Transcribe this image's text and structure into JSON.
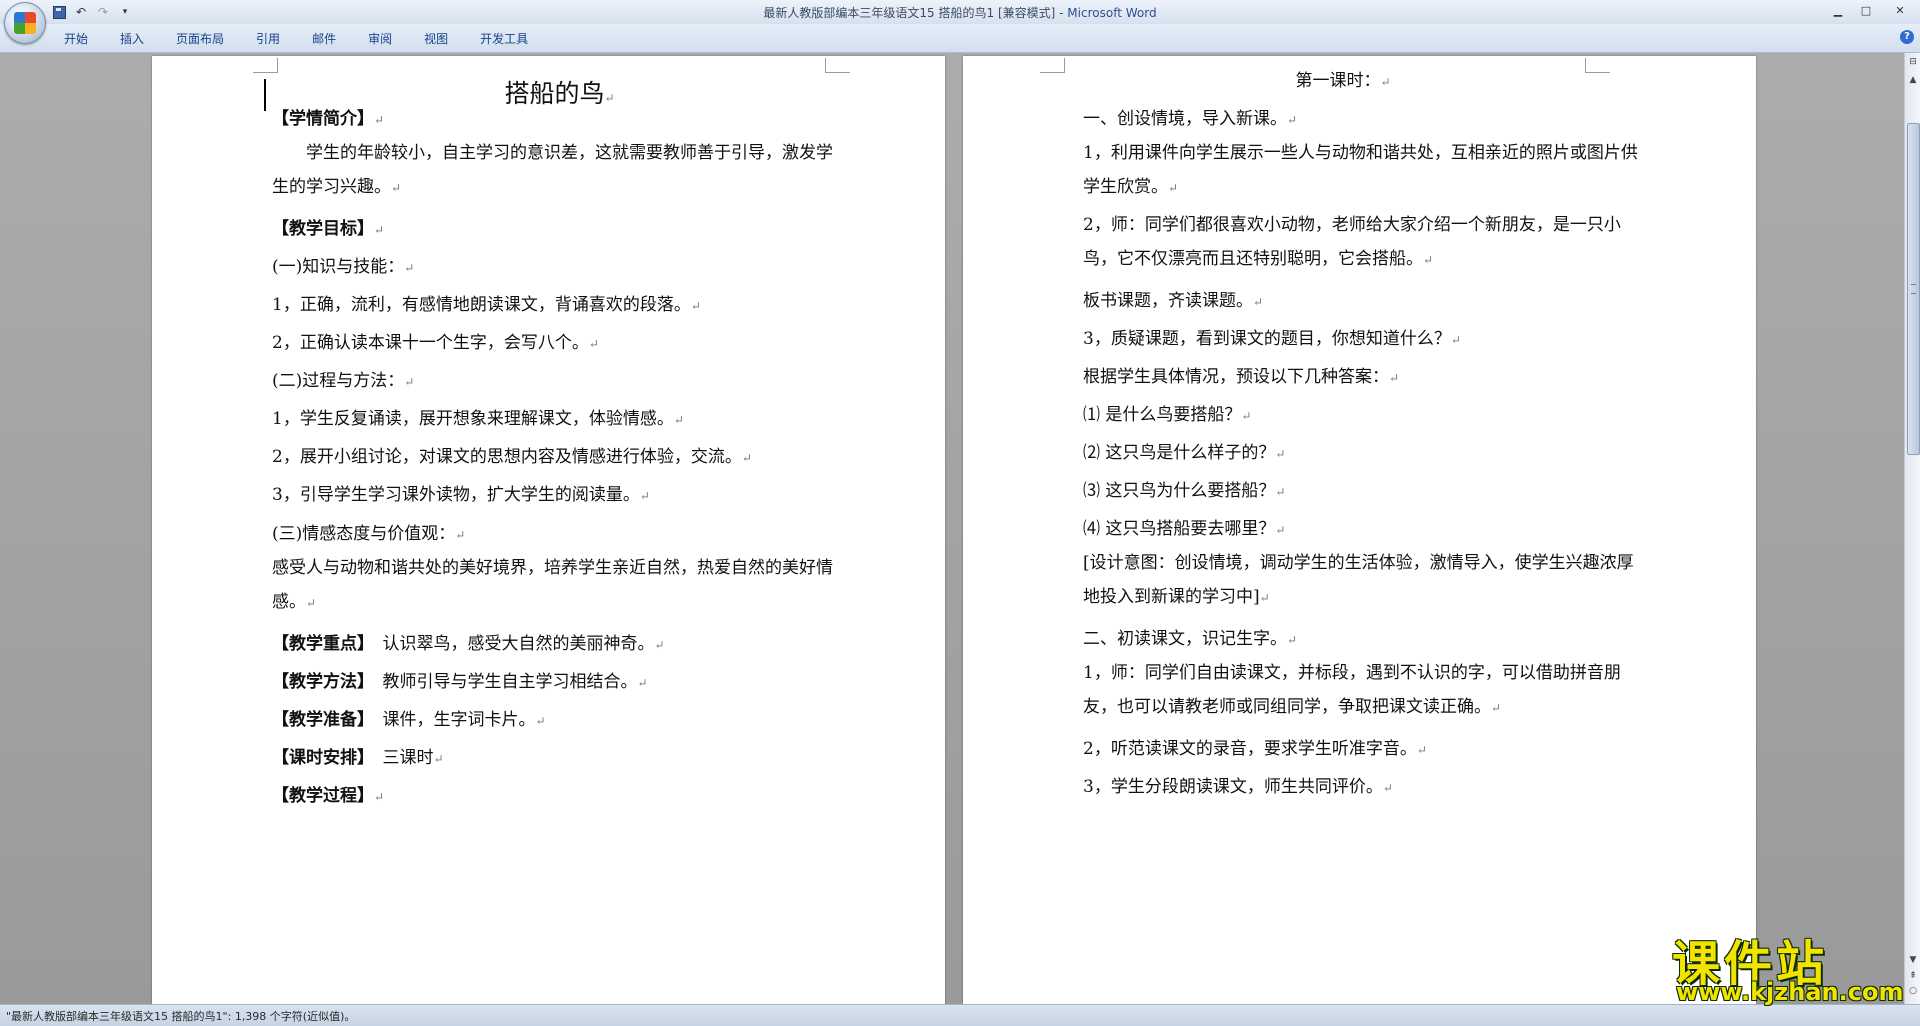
{
  "window": {
    "title": "最新人教版部编本三年级语文15 搭船的鸟1 [兼容模式]",
    "app_separator": " - ",
    "app_name": "Microsoft Word",
    "minimize": "▁",
    "maximize": "□",
    "close": "✕"
  },
  "qat": {
    "undo": "↶",
    "redo": "↷",
    "more": "▾"
  },
  "ribbon": {
    "tabs": [
      "开始",
      "插入",
      "页面布局",
      "引用",
      "邮件",
      "审阅",
      "视图",
      "开发工具"
    ],
    "help": "?"
  },
  "marks": {
    "para": "↵"
  },
  "document": {
    "left_page": {
      "title": "搭船的鸟",
      "paragraphs": [
        {
          "bold": "【学情简介】",
          "text": ""
        },
        {
          "bold": "",
          "text": "　　学生的年龄较小，自主学习的意识差，这就需要教师善于引导，激发学生的学习兴趣。"
        },
        {
          "bold": "【教学目标】",
          "text": ""
        },
        {
          "bold": "",
          "text": "(一)知识与技能："
        },
        {
          "bold": "",
          "text": "1，正确，流利，有感情地朗读课文，背诵喜欢的段落。"
        },
        {
          "bold": "",
          "text": "2，正确认读本课十一个生字，会写八个。"
        },
        {
          "bold": "",
          "text": "(二)过程与方法："
        },
        {
          "bold": "",
          "text": "1，学生反复诵读，展开想象来理解课文，体验情感。"
        },
        {
          "bold": "",
          "text": "2，展开小组讨论，对课文的思想内容及情感进行体验，交流。"
        },
        {
          "bold": "",
          "text": "3，引导学生学习课外读物，扩大学生的阅读量。"
        },
        {
          "bold": "",
          "text": "(三)情感态度与价值观："
        },
        {
          "bold": "",
          "text": "感受人与动物和谐共处的美好境界，培养学生亲近自然，热爱自然的美好情感。"
        },
        {
          "bold": "【教学重点】",
          "text": "　认识翠鸟，感受大自然的美丽神奇。"
        },
        {
          "bold": "【教学方法】",
          "text": "　教师引导与学生自主学习相结合。"
        },
        {
          "bold": "【教学准备】",
          "text": "　课件，生字词卡片。"
        },
        {
          "bold": "【课时安排】",
          "text": "　三课时"
        },
        {
          "bold": "【教学过程】",
          "text": ""
        }
      ]
    },
    "right_page": {
      "paragraphs": [
        {
          "text": "第一课时："
        },
        {
          "text": "一、创设情境，导入新课。"
        },
        {
          "text": "1，利用课件向学生展示一些人与动物和谐共处，互相亲近的照片或图片供学生欣赏。"
        },
        {
          "text": "2，师：同学们都很喜欢小动物，老师给大家介绍一个新朋友，是一只小鸟，它不仅漂亮而且还特别聪明，它会搭船。"
        },
        {
          "text": "板书课题，齐读课题。"
        },
        {
          "text": "3，质疑课题，看到课文的题目，你想知道什么？"
        },
        {
          "text": "根据学生具体情况，预设以下几种答案："
        },
        {
          "text": "⑴ 是什么鸟要搭船？"
        },
        {
          "text": "⑵ 这只鸟是什么样子的？"
        },
        {
          "text": "⑶ 这只鸟为什么要搭船？"
        },
        {
          "text": "⑷ 这只鸟搭船要去哪里？"
        },
        {
          "text": "[设计意图：创设情境，调动学生的生活体验，激情导入，使学生兴趣浓厚地投入到新课的学习中]"
        },
        {
          "text": "二、初读课文，识记生字。"
        },
        {
          "text": "1，师：同学们自由读课文，并标段，遇到不认识的字，可以借助拼音朋友，也可以请教老师或同组同学，争取把课文读正确。"
        },
        {
          "text": "2，听范读课文的录音，要求学生听准字音。"
        },
        {
          "text": "3，学生分段朗读课文，师生共同评价。"
        }
      ]
    }
  },
  "scrollbar": {
    "ruler": "⊟",
    "up": "▲",
    "down": "▼",
    "prev": "⇞",
    "select": "○"
  },
  "status": {
    "text": "\"最新人教版部编本三年级语文15 搭船的鸟1\": 1,398 个字符(近似值)。"
  },
  "watermark": {
    "main": "课件站",
    "url": "www.kjzhan.com"
  }
}
